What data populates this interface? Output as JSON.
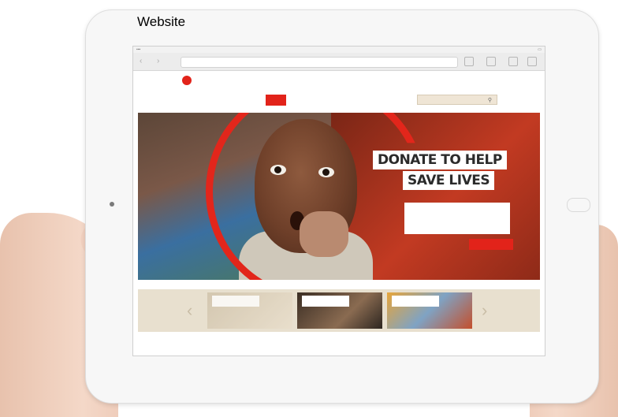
{
  "caption": "Website",
  "site": {
    "hero": {
      "headline_line1": "DONATE TO HELP",
      "headline_line2": "SAVE LIVES"
    }
  },
  "colors": {
    "brand_red": "#e2231a",
    "search_bg": "#efe5d5",
    "carousel_bg": "#e8e0cf"
  },
  "icons": {
    "back": "chevron-left-icon",
    "forward": "chevron-right-icon",
    "search": "magnifier-icon",
    "carousel_prev": "chevron-left-icon",
    "carousel_next": "chevron-right-icon"
  }
}
